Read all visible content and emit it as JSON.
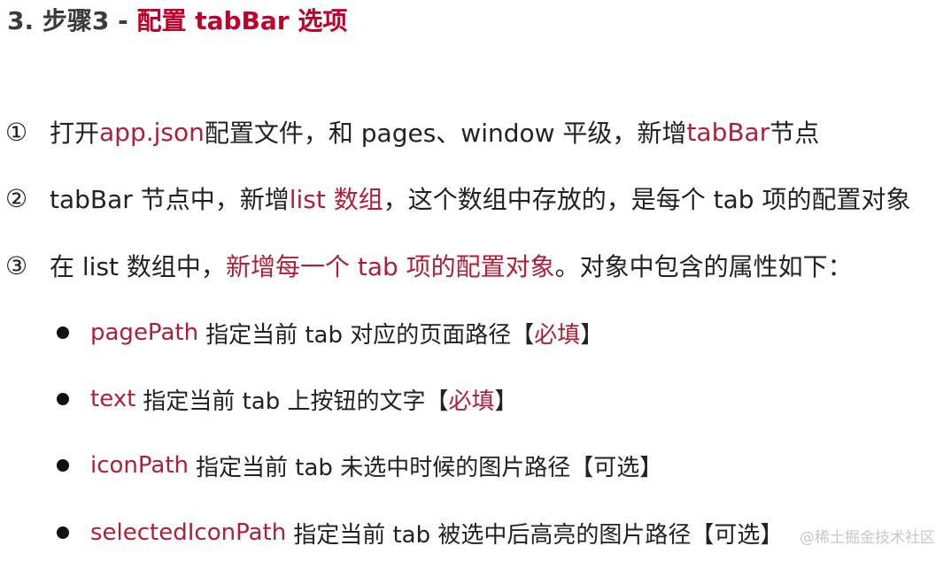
{
  "heading": {
    "prefix": "3. 步骤3 - ",
    "highlight": "配置 tabBar 选项"
  },
  "steps": [
    {
      "number": "①",
      "parts": [
        "打开 ",
        "app.json",
        " 配置文件，和 pages、window 平级，新增 ",
        "tabBar",
        " 节点"
      ]
    },
    {
      "number": "②",
      "parts": [
        "tabBar 节点中，新增 ",
        "list 数组",
        "，这个数组中存放的，是每个 tab 项的配置对象"
      ]
    },
    {
      "number": "③",
      "parts": [
        "在 list 数组中，",
        "新增每一个 tab 项的配置对象",
        "。对象中包含的属性如下："
      ]
    }
  ],
  "properties": [
    {
      "key": "pagePath",
      "desc": "指定当前 tab 对应的页面路径",
      "open": "【",
      "status": "必填",
      "close": "】"
    },
    {
      "key": "text",
      "desc": "指定当前 tab 上按钮的文字",
      "open": "【",
      "status": "必填",
      "close": "】"
    },
    {
      "key": "iconPath",
      "desc": "指定当前 tab 未选中时候的图片路径",
      "open": "【",
      "status": "可选",
      "close": "】"
    },
    {
      "key": "selectedIconPath",
      "desc": "指定当前 tab 被选中后高亮的图片路径",
      "open": "【",
      "status": "可选",
      "close": "】"
    }
  ],
  "watermark": "@稀土掘金技术社区"
}
